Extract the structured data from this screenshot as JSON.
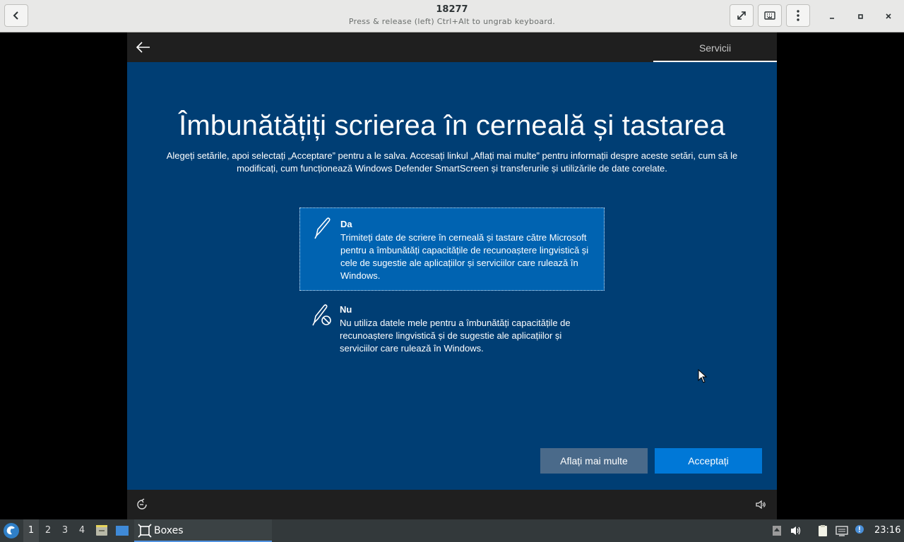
{
  "header": {
    "title": "18277",
    "subtitle": "Press & release (left) Ctrl+Alt to ungrab keyboard."
  },
  "oobe": {
    "step_label": "Servicii",
    "title": "Îmbunătățiți scrierea în cerneală și tastarea",
    "description": "Alegeți setările, apoi selectați „Acceptare” pentru a le salva. Accesați linkul „Aflați mai multe” pentru informații despre aceste setări, cum să le modificați, cum funcționează Windows Defender SmartScreen și transferurile și utilizările de date corelate.",
    "options": [
      {
        "heading": "Da",
        "body": "Trimiteți date de scriere în cerneală și tastare către Microsoft pentru a îmbunătăți capacitățile de recunoaștere lingvistică și cele de sugestie ale aplicațiilor și serviciilor care rulează în Windows.",
        "selected": true
      },
      {
        "heading": "Nu",
        "body": "Nu utiliza datele mele pentru a îmbunătăți capacitățile de recunoaștere lingvistică și de sugestie ale aplicațiilor și serviciilor care rulează în Windows.",
        "selected": false
      }
    ],
    "learn_more_label": "Aflați mai multe",
    "accept_label": "Acceptați"
  },
  "taskbar": {
    "workspaces": [
      "1",
      "2",
      "3",
      "4"
    ],
    "active_workspace": "1",
    "task_label": "Boxes",
    "clock": "23:16"
  },
  "colors": {
    "oobe_background": "#003e74",
    "selected_option": "#0063b1",
    "accept_button": "#0078d7",
    "learn_button": "#4a6a8a"
  }
}
